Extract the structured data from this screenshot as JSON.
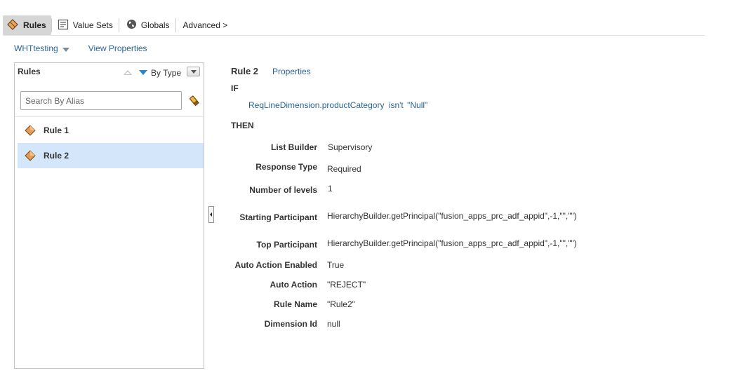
{
  "tabs": [
    {
      "label": "Rules",
      "icon": "rules-icon",
      "active": true
    },
    {
      "label": "Value Sets",
      "icon": "value-sets-icon",
      "active": false
    },
    {
      "label": "Globals",
      "icon": "globe-icon",
      "active": false
    },
    {
      "label": "Advanced >",
      "icon": "",
      "active": false
    }
  ],
  "subbar": {
    "ruleset": "WHTtesting",
    "view_properties": "View Properties"
  },
  "rules_panel": {
    "title": "Rules",
    "sort_label": "By Type",
    "search_placeholder": "Search By Alias",
    "items": [
      {
        "label": "Rule 1",
        "selected": false
      },
      {
        "label": "Rule 2",
        "selected": true
      }
    ]
  },
  "detail": {
    "title": "Rule 2",
    "properties_link": "Properties",
    "if_keyword": "IF",
    "condition": {
      "attribute": "ReqLineDimension.productCategory",
      "operator": "isn't",
      "value": "\"Null\""
    },
    "then_keyword": "THEN",
    "properties": [
      {
        "label": "List Builder",
        "value": "Supervisory"
      },
      {
        "label": "Response Type",
        "value": "Required"
      },
      {
        "label": "Number of levels",
        "value": "1"
      },
      {
        "label": "Starting Participant",
        "value": "HierarchyBuilder.getPrincipal(\"fusion_apps_prc_adf_appid\",-1,\"\",\"\")"
      },
      {
        "label": "Top Participant",
        "value": "HierarchyBuilder.getPrincipal(\"fusion_apps_prc_adf_appid\",-1,\"\",\"\")"
      },
      {
        "label": "Auto Action Enabled",
        "value": "True"
      },
      {
        "label": "Auto Action",
        "value": "\"REJECT\""
      },
      {
        "label": "Rule Name",
        "value": "\"Rule2\""
      },
      {
        "label": "Dimension Id",
        "value": "null"
      }
    ]
  },
  "colors": {
    "link": "#2a6496",
    "selected_row": "#d4e7fa",
    "active_tab": "#d6d6d6",
    "rule_icon": "#d98a3c"
  }
}
